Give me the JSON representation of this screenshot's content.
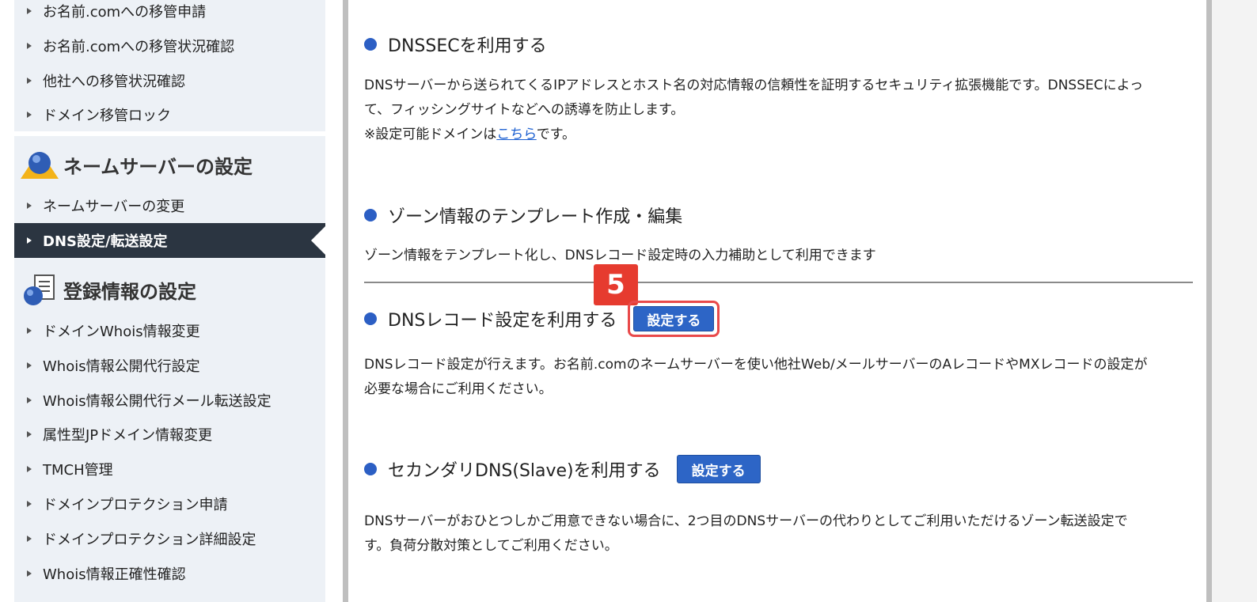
{
  "sidebar": {
    "transfer_items": [
      {
        "label": "お名前.comへの移管申請"
      },
      {
        "label": "お名前.comへの移管状況確認"
      },
      {
        "label": "他社への移管状況確認"
      },
      {
        "label": "ドメイン移管ロック"
      }
    ],
    "nameserver_section": {
      "title": "ネームサーバーの設定",
      "icon": "person-globe-icon",
      "items": [
        {
          "label": "ネームサーバーの変更"
        },
        {
          "label": "DNS設定/転送設定",
          "active": true
        }
      ]
    },
    "registration_section": {
      "title": "登録情報の設定",
      "icon": "document-globe-icon",
      "items": [
        {
          "label": "ドメインWhois情報変更"
        },
        {
          "label": "Whois情報公開代行設定"
        },
        {
          "label": "Whois情報公開代行メール転送設定"
        },
        {
          "label": "属性型JPドメイン情報変更"
        },
        {
          "label": "TMCH管理"
        },
        {
          "label": "ドメインプロテクション申請"
        },
        {
          "label": "ドメインプロテクション詳細設定"
        },
        {
          "label": "Whois情報正確性確認"
        }
      ]
    }
  },
  "main": {
    "dnssec": {
      "title": "DNSSECを利用する",
      "desc_line1": "DNSサーバーから送られてくるIPアドレスとホスト名の対応情報の信頼性を証明するセキュリティ拡張機能です。DNSSECによっ",
      "desc_line2": "て、フィッシングサイトなどへの誘導を防止します。",
      "note_prefix": "※設定可能ドメインは",
      "note_link": "こちら",
      "note_suffix": "です。"
    },
    "zone_template": {
      "title": "ゾーン情報のテンプレート作成・編集",
      "desc": "ゾーン情報をテンプレート化し、DNSレコード設定時の入力補助として利用できます"
    },
    "dns_record": {
      "title": "DNSレコード設定を利用する",
      "button": "設定する",
      "desc_line1": "DNSレコード設定が行えます。お名前.comのネームサーバーを使い他社Web/メールサーバーのAレコードやMXレコードの設定が",
      "desc_line2": "必要な場合にご利用ください。"
    },
    "secondary_dns": {
      "title": "セカンダリDNS(Slave)を利用する",
      "button": "設定する",
      "desc_line1": "DNSサーバーがおひとつしかご用意できない場合に、2つ目のDNSサーバーの代わりとしてご利用いただけるゾーン転送設定で",
      "desc_line2": "す。負荷分散対策としてご利用ください。"
    },
    "step_badge": "5"
  },
  "colors": {
    "accent": "#2d65c6",
    "highlight": "#e9494a",
    "sidebar_bg": "#edf1f6",
    "active_bg": "#2b3541"
  }
}
